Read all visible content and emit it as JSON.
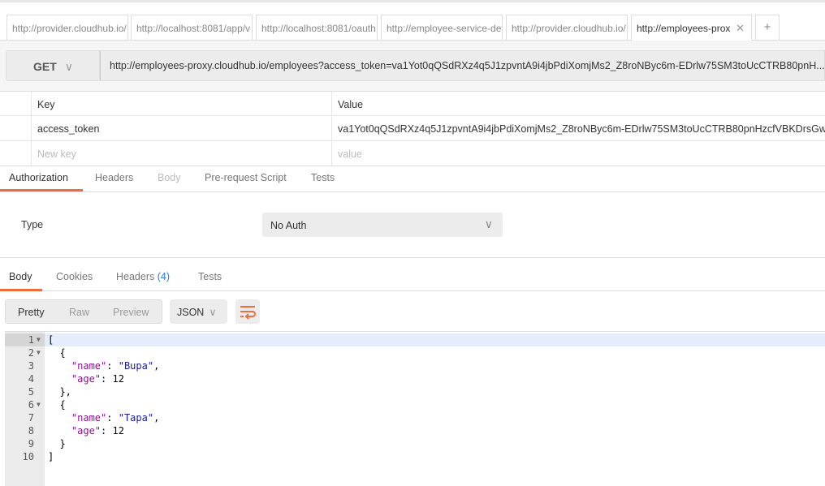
{
  "tabs": [
    {
      "label": "http://provider.cloudhub.io/"
    },
    {
      "label": "http://localhost:8081/app/v"
    },
    {
      "label": "http://localhost:8081/oauth"
    },
    {
      "label": "http://employee-service-dev"
    },
    {
      "label": "http://provider.cloudhub.io/"
    },
    {
      "label": "http://employees-prox",
      "active": true
    }
  ],
  "new_tab": "+",
  "close": "✕",
  "request": {
    "method": "GET",
    "url": "http://employees-proxy.cloudhub.io/employees?access_token=va1Yot0qQSdRXz4q5J1zpvntA9i4jbPdiXomjMs2_Z8roNByc6m-EDrlw75SM3toUcCTRB80pnH..."
  },
  "params": {
    "key_header": "Key",
    "value_header": "Value",
    "rows": [
      {
        "key": "access_token",
        "value": "va1Yot0qQSdRXz4q5J1zpvntA9i4jbPdiXomjMs2_Z8roNByc6m-EDrlw75SM3toUcCTRB80pnHzcfVBKDrsGw"
      }
    ],
    "new_key_placeholder": "New key",
    "value_placeholder": "value"
  },
  "req_tabs": [
    "Authorization",
    "Headers",
    "Body",
    "Pre-request Script",
    "Tests"
  ],
  "auth": {
    "type_label": "Type",
    "type_value": "No Auth"
  },
  "resp_tabs": {
    "body": "Body",
    "cookies": "Cookies",
    "headers": "Headers",
    "headers_count": "(4)",
    "tests": "Tests"
  },
  "view": {
    "pretty": "Pretty",
    "raw": "Raw",
    "preview": "Preview",
    "format": "JSON"
  },
  "colors": {
    "accent": "#f26b3a",
    "link": "#2a7ae2"
  },
  "body_lines": [
    "[",
    "  {",
    "    \"name\": \"Bupa\",",
    "    \"age\": 12",
    "  },",
    "  {",
    "    \"name\": \"Tapa\",",
    "    \"age\": 12",
    "  }",
    "]"
  ]
}
